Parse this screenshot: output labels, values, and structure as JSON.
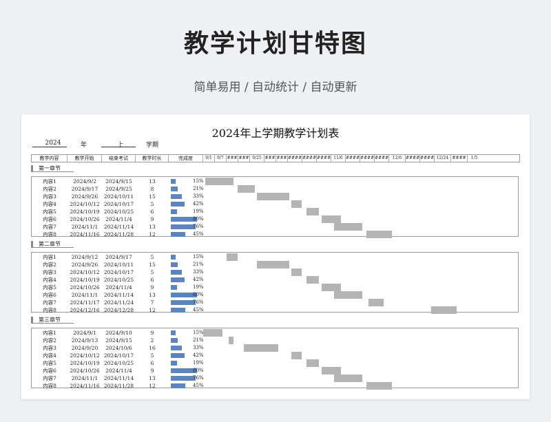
{
  "page_title": "教学计划甘特图",
  "subtitle": "简单易用  /  自动统计  /  自动更新",
  "sheet": {
    "title": "2024年上学期教学计划表",
    "year": "2024",
    "year_label": "年",
    "term": "上",
    "term_label": "学期",
    "headers": [
      "教学内容",
      "教学开始",
      "结束考试",
      "教学时长",
      "完成度"
    ],
    "date_headers": [
      "9/1",
      "9/7",
      "###",
      "###",
      "9/25",
      "###",
      "###",
      "####",
      "####",
      "####",
      "11/6",
      "####",
      "####",
      "####",
      "12/6",
      "####",
      "####",
      "12/24",
      "####",
      "1/5"
    ],
    "chapters": [
      {
        "label": "第一章节",
        "rows": [
          {
            "name": "内容1",
            "start": "2024/9/2",
            "end": "2024/9/15",
            "days": "13",
            "pct": "15%",
            "s": 1,
            "e": 14
          },
          {
            "name": "内容2",
            "start": "2024/9/17",
            "end": "2024/9/25",
            "days": "8",
            "pct": "21%",
            "s": 16,
            "e": 24
          },
          {
            "name": "内容3",
            "start": "2024/9/26",
            "end": "2024/10/11",
            "days": "15",
            "pct": "33%",
            "s": 25,
            "e": 40
          },
          {
            "name": "内容4",
            "start": "2024/10/12",
            "end": "2024/10/17",
            "days": "5",
            "pct": "42%",
            "s": 41,
            "e": 46
          },
          {
            "name": "内容5",
            "start": "2024/10/19",
            "end": "2024/10/25",
            "days": "6",
            "pct": "19%",
            "s": 48,
            "e": 54
          },
          {
            "name": "内容6",
            "start": "2024/10/26",
            "end": "2024/11/4",
            "days": "9",
            "pct": "80%",
            "s": 55,
            "e": 64
          },
          {
            "name": "内容7",
            "start": "2024/11/1",
            "end": "2024/11/14",
            "days": "13",
            "pct": "76%",
            "s": 61,
            "e": 74
          },
          {
            "name": "内容8",
            "start": "2024/11/16",
            "end": "2024/11/28",
            "days": "12",
            "pct": "45%",
            "s": 76,
            "e": 88
          }
        ]
      },
      {
        "label": "第二章节",
        "rows": [
          {
            "name": "内容1",
            "start": "2024/9/12",
            "end": "2024/9/17",
            "days": "5",
            "pct": "15%",
            "s": 11,
            "e": 16
          },
          {
            "name": "内容2",
            "start": "2024/9/26",
            "end": "2024/10/11",
            "days": "15",
            "pct": "21%",
            "s": 25,
            "e": 40
          },
          {
            "name": "内容3",
            "start": "2024/10/12",
            "end": "2024/10/17",
            "days": "5",
            "pct": "33%",
            "s": 41,
            "e": 46
          },
          {
            "name": "内容4",
            "start": "2024/10/19",
            "end": "2024/10/25",
            "days": "6",
            "pct": "42%",
            "s": 48,
            "e": 54
          },
          {
            "name": "内容5",
            "start": "2024/10/26",
            "end": "2024/11/4",
            "days": "9",
            "pct": "19%",
            "s": 55,
            "e": 64
          },
          {
            "name": "内容6",
            "start": "2024/11/1",
            "end": "2024/11/14",
            "days": "13",
            "pct": "80%",
            "s": 61,
            "e": 74
          },
          {
            "name": "内容7",
            "start": "2024/11/17",
            "end": "2024/11/24",
            "days": "7",
            "pct": "76%",
            "s": 77,
            "e": 84
          },
          {
            "name": "内容8",
            "start": "2024/12/16",
            "end": "2024/12/28",
            "days": "12",
            "pct": "45%",
            "s": 106,
            "e": 118
          }
        ]
      },
      {
        "label": "第三章节",
        "rows": [
          {
            "name": "内容1",
            "start": "2024/9/1",
            "end": "2024/9/10",
            "days": "9",
            "pct": "15%",
            "s": 0,
            "e": 9
          },
          {
            "name": "内容2",
            "start": "2024/9/13",
            "end": "2024/9/15",
            "days": "2",
            "pct": "21%",
            "s": 12,
            "e": 14
          },
          {
            "name": "内容3",
            "start": "2024/9/20",
            "end": "2024/10/6",
            "days": "16",
            "pct": "33%",
            "s": 19,
            "e": 35
          },
          {
            "name": "内容4",
            "start": "2024/10/12",
            "end": "2024/10/17",
            "days": "5",
            "pct": "42%",
            "s": 41,
            "e": 46
          },
          {
            "name": "内容5",
            "start": "2024/10/19",
            "end": "2024/10/25",
            "days": "6",
            "pct": "19%",
            "s": 48,
            "e": 54
          },
          {
            "name": "内容6",
            "start": "2024/10/26",
            "end": "2024/11/4",
            "days": "9",
            "pct": "80%",
            "s": 55,
            "e": 64
          },
          {
            "name": "内容7",
            "start": "2024/11/1",
            "end": "2024/11/14",
            "days": "13",
            "pct": "76%",
            "s": 61,
            "e": 74
          },
          {
            "name": "内容8",
            "start": "2024/11/16",
            "end": "2024/11/28",
            "days": "12",
            "pct": "45%",
            "s": 76,
            "e": 88
          }
        ]
      }
    ]
  },
  "colors": {
    "progress_bar": "#5b84c0",
    "gantt_bar": "#b4b4b4"
  }
}
